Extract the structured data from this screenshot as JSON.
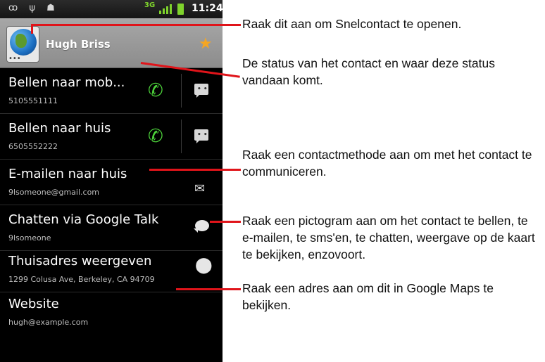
{
  "status_bar": {
    "left_icons": "ꝏ ψ ☗",
    "network": "3G",
    "time": "11:24",
    "accent_color": "#7fd32c"
  },
  "header": {
    "contact_name": "Hugh Briss",
    "favorite_star_color": "#f5a623"
  },
  "rows": [
    {
      "title": "Bellen naar mob...",
      "sub": "5105551111",
      "action_icon": "phone-icon",
      "secondary_icon": "sms-icon"
    },
    {
      "title": "Bellen naar huis",
      "sub": "6505552222",
      "action_icon": "phone-icon",
      "secondary_icon": "sms-icon"
    },
    {
      "title": "E-mailen naar huis",
      "sub": "9lsomeone@gmail.com",
      "action_icon": "mail-icon"
    },
    {
      "title": "Chatten via Google Talk",
      "sub": "9lsomeone",
      "action_icon": "chat-icon"
    },
    {
      "title": "Thuisadres weergeven",
      "sub": "1299 Colusa Ave, Berkeley, CA 94709",
      "action_icon": "map-pin-icon"
    },
    {
      "title": "Website",
      "sub": "hugh@example.com"
    }
  ],
  "callouts": {
    "quick_contact": "Raak dit aan om Snelcontact te openen.",
    "status": "De status van het contact en waar deze status vandaan komt.",
    "method": "Raak een contactmethode aan om met het contact te communiceren.",
    "icon": "Raak een pictogram aan om het contact te bellen, te e-mailen, te sms'en, te chatten, weergave op de kaart te bekijken, enzovoort.",
    "address": "Raak een adres aan om dit in Google Maps te bekijken."
  },
  "callout_line_color": "#e0141a"
}
